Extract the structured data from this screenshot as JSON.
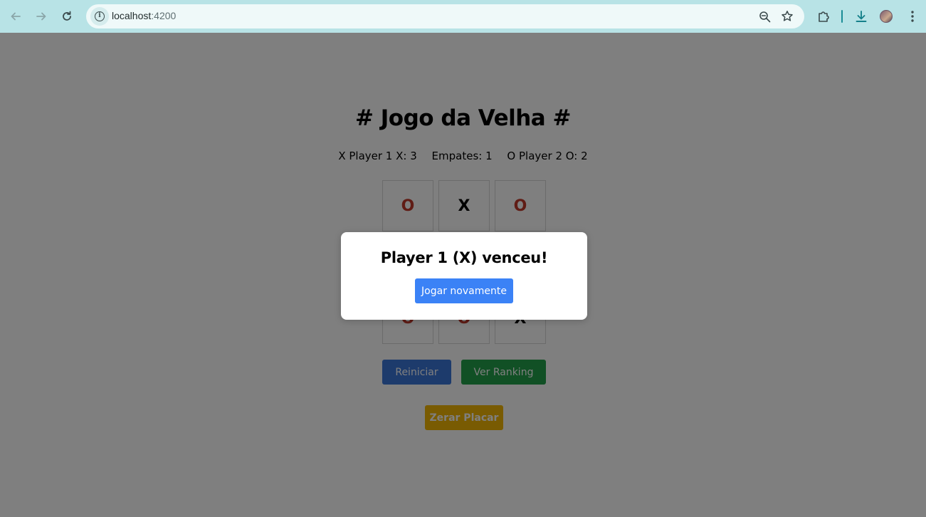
{
  "browser": {
    "url_host": "localhost",
    "url_port": ":4200",
    "icons": {
      "back": "back-arrow-icon",
      "forward": "forward-arrow-icon",
      "reload": "reload-icon",
      "site_info": "info-icon",
      "zoom": "zoom-out-icon",
      "bookmark": "star-icon",
      "extensions": "puzzle-icon",
      "downloads": "download-icon",
      "profile": "avatar-icon",
      "menu": "kebab-menu-icon"
    }
  },
  "game": {
    "title": "# Jogo da Velha #",
    "score": {
      "player1": "X Player 1 X: 3",
      "draws": "Empates: 1",
      "player2": "O Player 2 O: 2"
    },
    "board": [
      [
        "O",
        "X",
        "O"
      ],
      [
        "",
        "",
        ""
      ],
      [
        "O",
        "O",
        "X"
      ]
    ],
    "buttons": {
      "restart": "Reiniciar",
      "ranking": "Ver Ranking",
      "reset_score": "Zerar Placar"
    },
    "colors": {
      "o_mark": "#c0392b",
      "x_mark": "#000000",
      "restart": "#3b76d9",
      "ranking": "#22a04b",
      "reset_score": "#f2b705"
    }
  },
  "modal": {
    "title": "Player 1 (X) venceu!",
    "play_again": "Jogar novamente",
    "button_color": "#3b82f6"
  }
}
